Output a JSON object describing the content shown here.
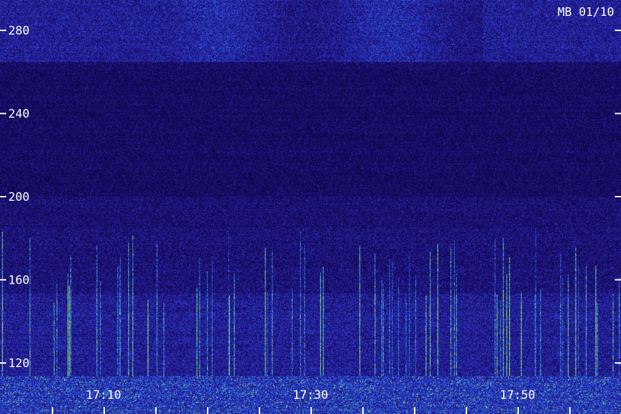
{
  "chart_data": {
    "type": "heatmap",
    "title": "MB 01/10",
    "x_tick_labels": [
      "17:10",
      "17:30",
      "17:50"
    ],
    "y_tick_values": [
      120,
      160,
      200,
      240,
      280
    ],
    "y_tick_labels": [
      "120",
      "160",
      "200",
      "240",
      "280"
    ],
    "ylim": [
      110,
      290
    ],
    "colors": {
      "background": "#0a0030",
      "low": "#1a0c6a",
      "mid": "#2f3fd8",
      "high": "#29d6f2",
      "peak": "#c8ff40",
      "text": "#ffffff"
    }
  }
}
